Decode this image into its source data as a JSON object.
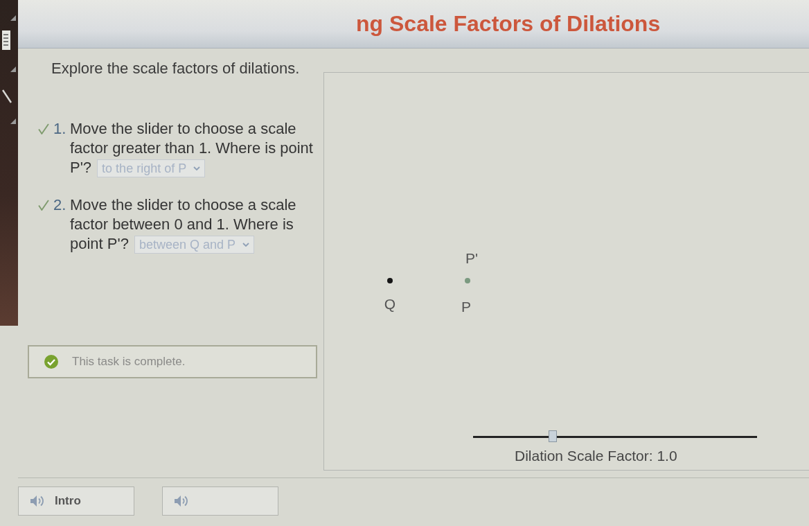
{
  "header": {
    "title": "ng Scale Factors of Dilations"
  },
  "instructions": "Explore the scale factors of dilations.",
  "questions": [
    {
      "number": "1.",
      "checked": true,
      "text": "Move the slider to choose a scale factor greater than 1. Where is point P'?",
      "answer": {
        "value": "to the right of P",
        "disabled": true
      }
    },
    {
      "number": "2.",
      "checked": true,
      "text": "Move the slider to choose a scale factor between 0 and 1. Where is point P'?",
      "answer": {
        "value": "between Q and P",
        "disabled": true
      }
    }
  ],
  "status": {
    "complete": true,
    "message": "This task is complete."
  },
  "graph": {
    "points": [
      {
        "label": "Q",
        "kind": "center"
      },
      {
        "label": "P",
        "kind": "point"
      },
      {
        "label": "P'",
        "kind": "image"
      }
    ]
  },
  "slider": {
    "level": 0.28,
    "label": "Dilation Scale Factor: 1.0"
  },
  "footer": {
    "buttons": [
      {
        "kind": "audio",
        "label": "Intro"
      },
      {
        "kind": "audio"
      }
    ]
  }
}
